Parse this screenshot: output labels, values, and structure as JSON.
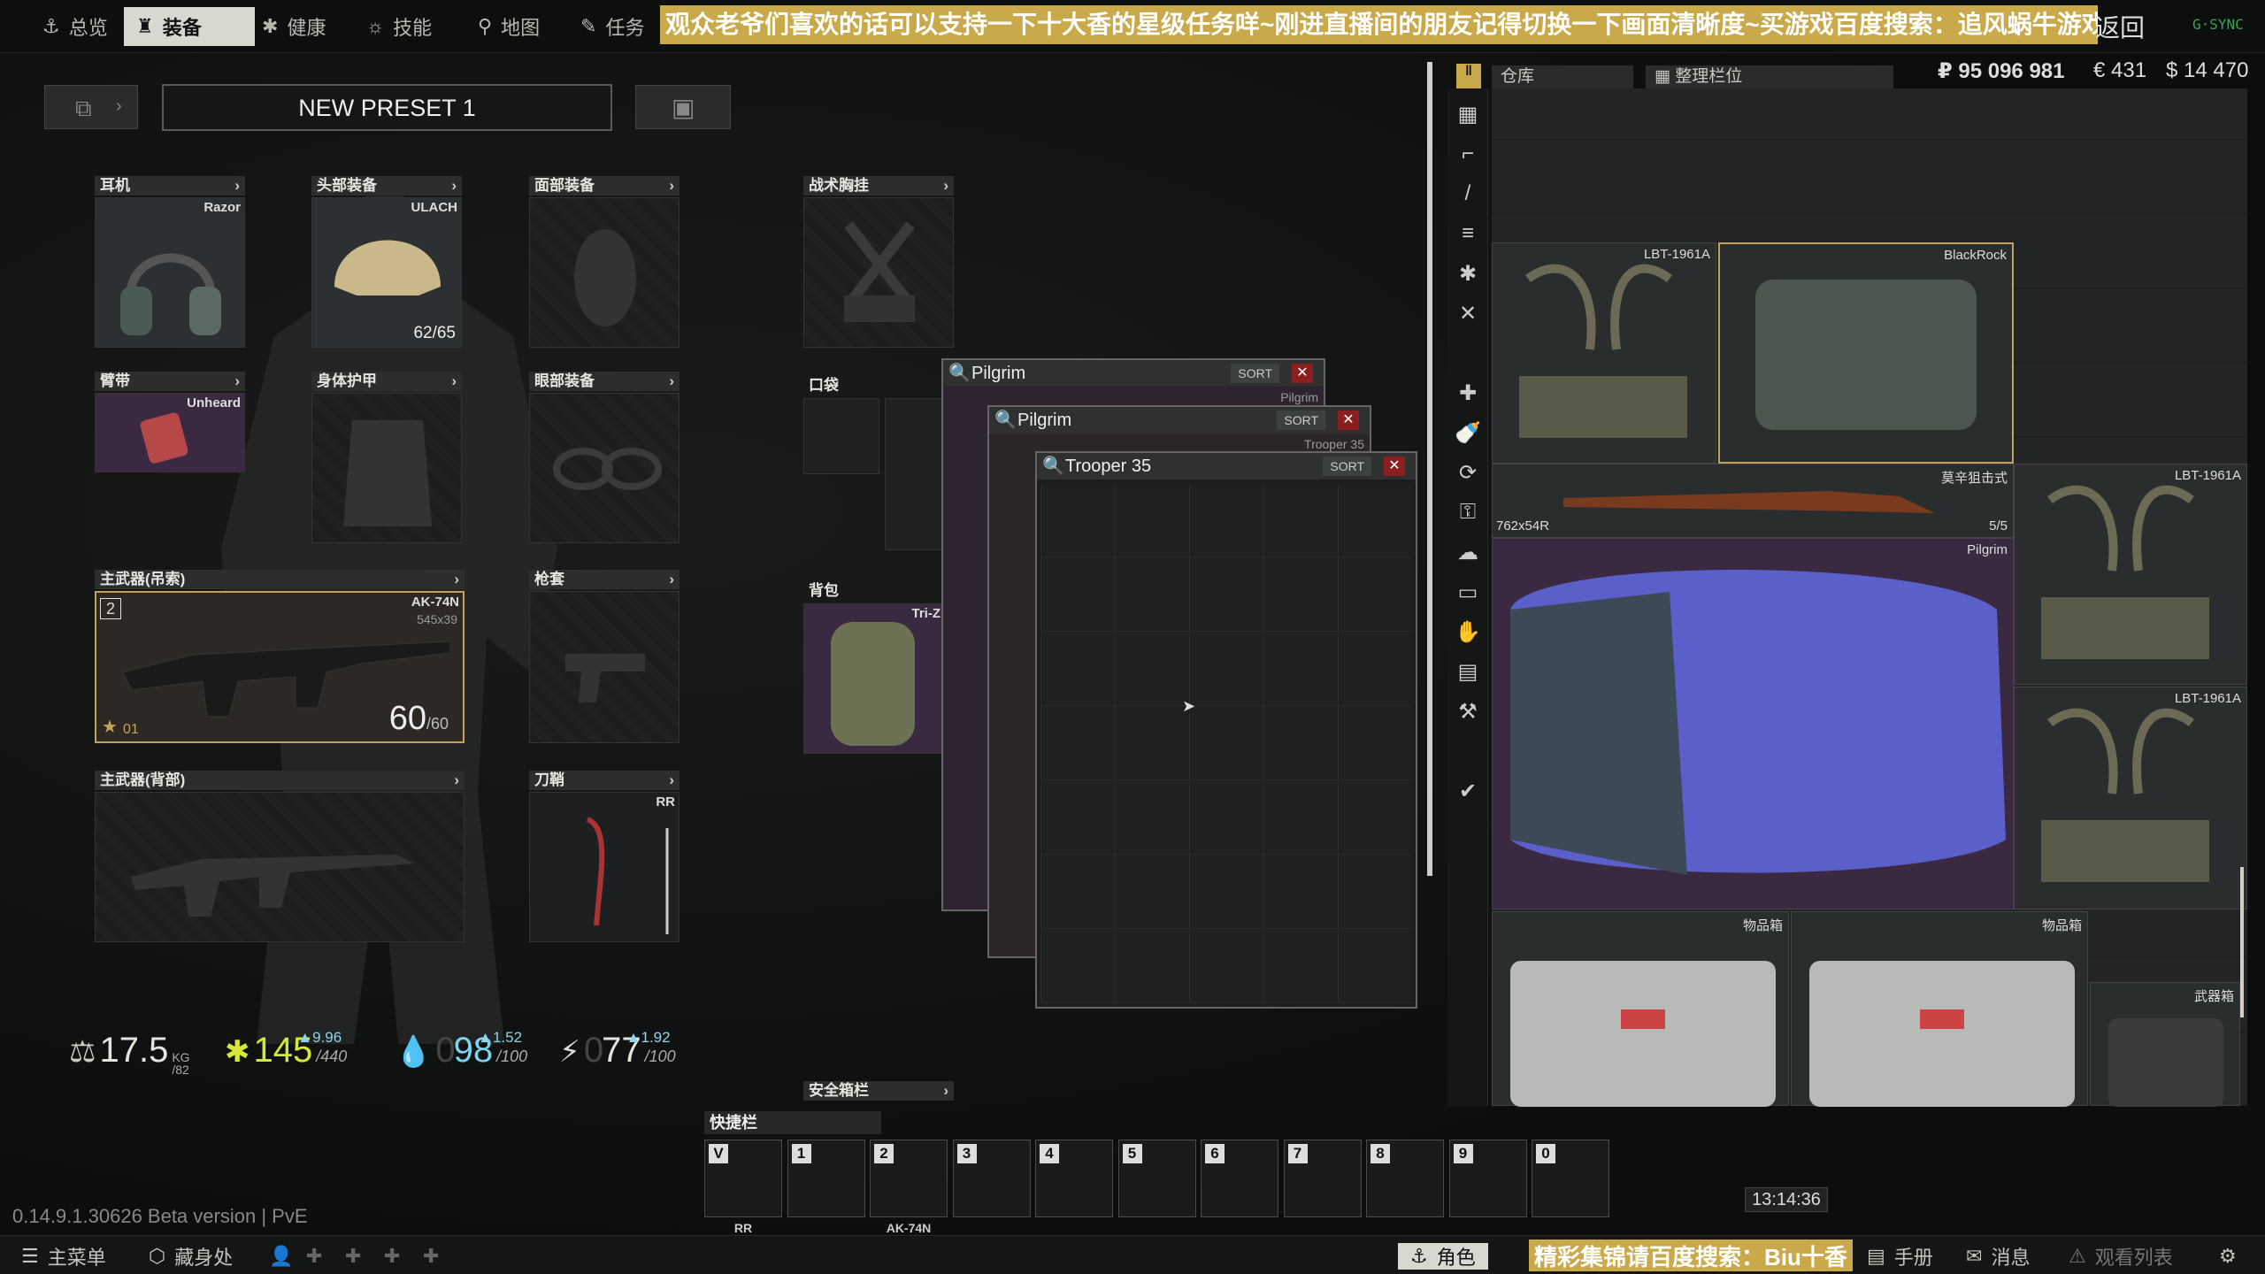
{
  "nav": {
    "tabs": [
      {
        "label": "总览",
        "icon": "anchor-icon"
      },
      {
        "label": "装备",
        "icon": "armor-icon",
        "active": true
      },
      {
        "label": "健康",
        "icon": "health-icon"
      },
      {
        "label": "技能",
        "icon": "skills-icon"
      },
      {
        "label": "地图",
        "icon": "map-pin-icon"
      },
      {
        "label": "任务",
        "icon": "tasks-icon"
      }
    ],
    "banner": "观众老爷们喜欢的话可以支持一下十大香的星级任务咩~刚进直播间的朋友记得切换一下画面清晰度~买游戏百度搜索：追风蜗牛游戏",
    "back_label": "返回",
    "gsync": "G·SYNC"
  },
  "preset": {
    "name": "NEW PRESET 1"
  },
  "slots": {
    "earpiece": {
      "label": "耳机",
      "item": "Razor"
    },
    "headwear": {
      "label": "头部装备",
      "item": "ULACH",
      "durability": "62/65"
    },
    "facecover": {
      "label": "面部装备"
    },
    "tactical_rig": {
      "label": "战术胸挂"
    },
    "armband": {
      "label": "臂带",
      "item": "Unheard"
    },
    "body_armor": {
      "label": "身体护甲"
    },
    "eyewear": {
      "label": "眼部装备"
    },
    "pockets": {
      "label": "口袋"
    },
    "primary_sling": {
      "label": "主武器(吊索)",
      "item": "AK-74N",
      "ammo_type": "545x39",
      "ammo": "60",
      "ammo_max": "/60",
      "slot_num": "2",
      "rank": "01"
    },
    "holster": {
      "label": "枪套"
    },
    "backpack": {
      "label": "背包",
      "item": "Tri-Z"
    },
    "primary_back": {
      "label": "主武器(背部)"
    },
    "scabbard": {
      "label": "刀鞘",
      "item": "RR"
    },
    "secure": {
      "label": "安全箱栏"
    }
  },
  "stats": {
    "weight": {
      "value": "17.5",
      "unit": "KG",
      "max": "/82"
    },
    "energy": {
      "value": "145",
      "max": "/440",
      "delta": "▲9.96"
    },
    "hydration": {
      "value": "98",
      "max": "/100",
      "prefix": "0",
      "delta": "▲1.52"
    },
    "stamina": {
      "value": "77",
      "max": "/100",
      "prefix": "0",
      "delta": "▲1.92"
    }
  },
  "windows": [
    {
      "title": "Pilgrim",
      "sort": "SORT",
      "sub": "Pilgrim"
    },
    {
      "title": "Pilgrim",
      "sort": "SORT",
      "sub": "Trooper 35"
    },
    {
      "title": "Trooper 35",
      "sort": "SORT"
    }
  ],
  "stash": {
    "tab_label": "仓库",
    "sort_tab_label": "整理栏位",
    "currency": {
      "rub": "₽ 95 096 981",
      "eur": "€ 431",
      "usd": "$ 14 470"
    },
    "items": [
      {
        "name": "LBT-1961A"
      },
      {
        "name": "BlackRock"
      },
      {
        "name": "莫辛狙击式",
        "caliber": "762x54R",
        "count": "5/5"
      },
      {
        "name": "Pilgrim"
      },
      {
        "name": "LBT-1961A"
      },
      {
        "name": "LBT-1961A"
      },
      {
        "name": "物品箱"
      },
      {
        "name": "物品箱"
      },
      {
        "name": "武器箱"
      }
    ]
  },
  "quickbar": {
    "label": "快捷栏",
    "slots": [
      {
        "key": "V",
        "label": "RR"
      },
      {
        "key": "1",
        "label": ""
      },
      {
        "key": "2",
        "label": "AK-74N"
      },
      {
        "key": "3",
        "label": ""
      },
      {
        "key": "4",
        "label": ""
      },
      {
        "key": "5",
        "label": ""
      },
      {
        "key": "6",
        "label": ""
      },
      {
        "key": "7",
        "label": ""
      },
      {
        "key": "8",
        "label": ""
      },
      {
        "key": "9",
        "label": ""
      },
      {
        "key": "0",
        "label": ""
      }
    ]
  },
  "version": "0.14.9.1.30626 Beta version | PvE",
  "clock": "13:14:36",
  "bottom": {
    "menu": "主菜单",
    "hideout": "藏身处",
    "character": "角色",
    "banner2": "精彩集锦请百度搜索：Biu十香",
    "handbook": "手册",
    "messages": "消息",
    "watchlist": "观看列表"
  }
}
